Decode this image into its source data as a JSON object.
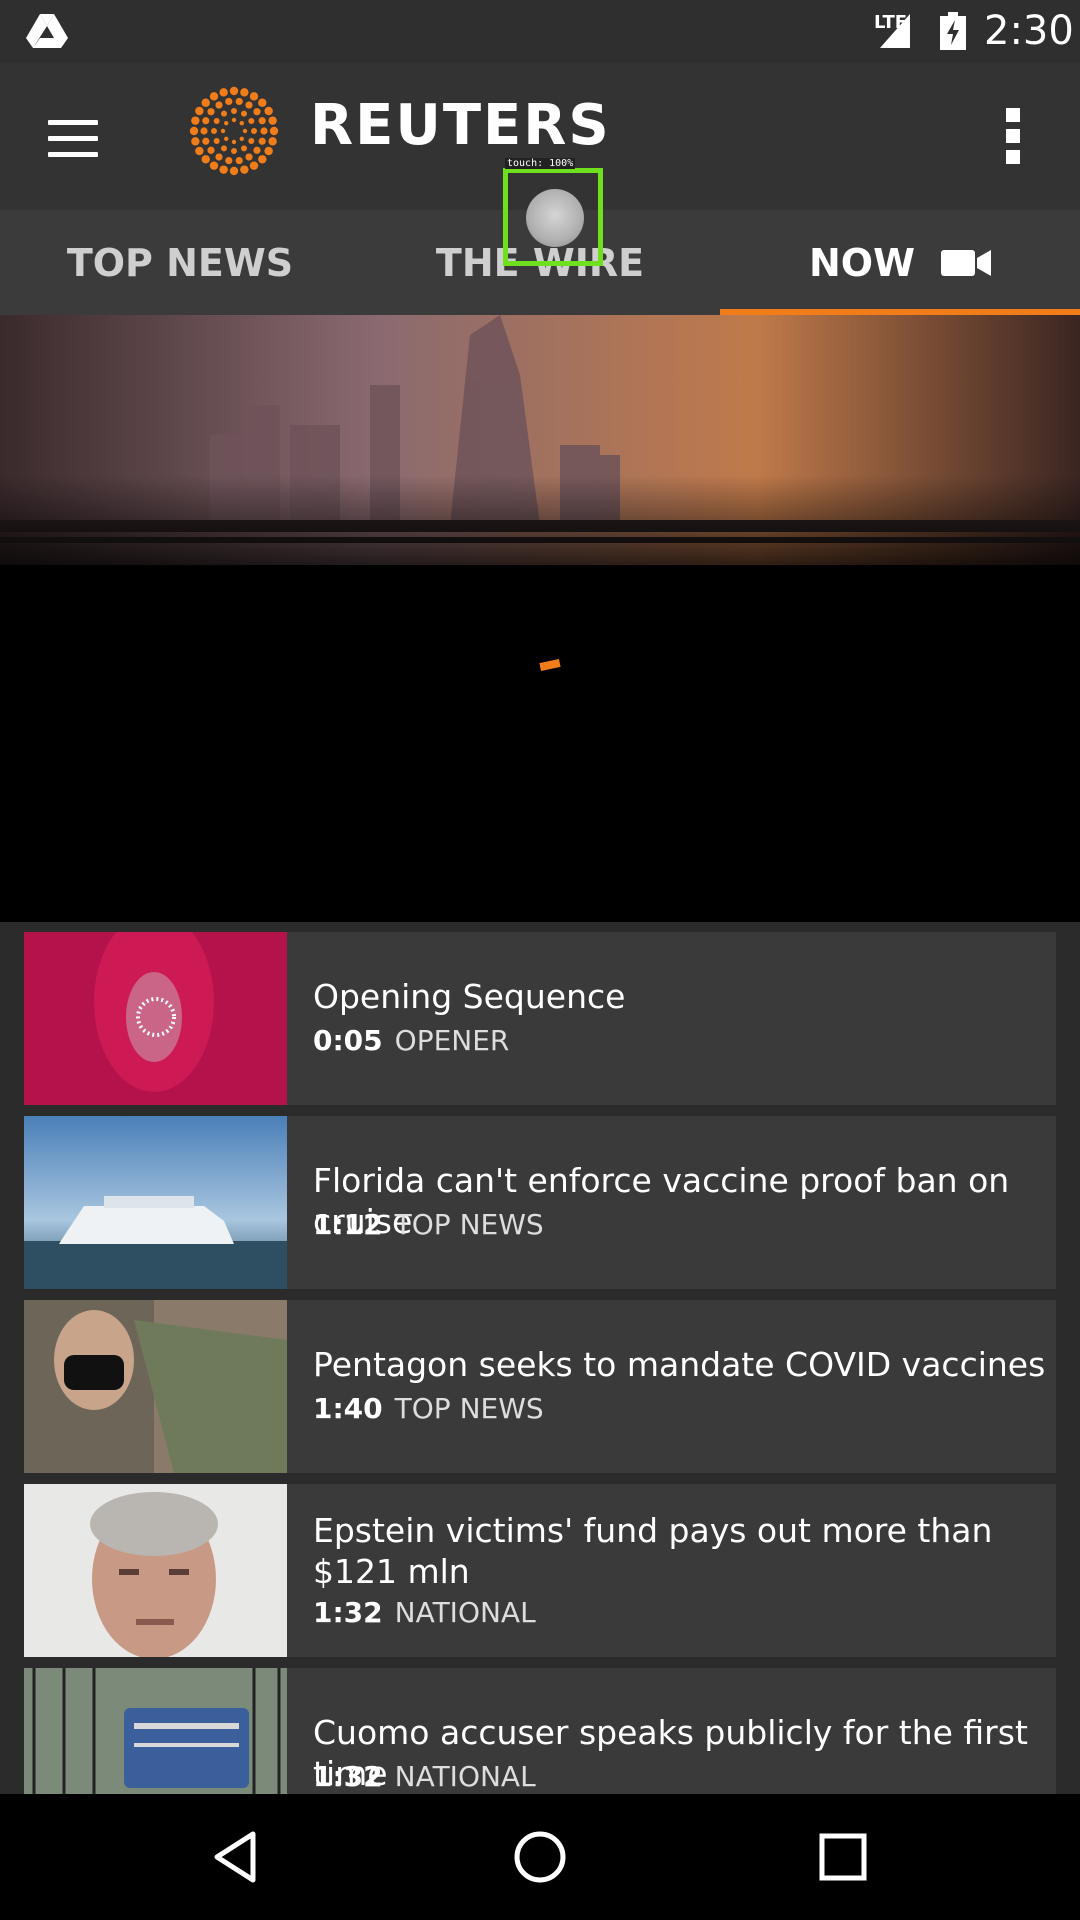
{
  "status_bar": {
    "network": "LTE",
    "time": "2:30"
  },
  "app_bar": {
    "brand": "REUTERS"
  },
  "tabs": [
    {
      "label": "TOP NEWS",
      "selected": false
    },
    {
      "label": "THE WIRE",
      "selected": false
    },
    {
      "label": "NOW",
      "selected": true
    }
  ],
  "touch_overlay": {
    "label": "touch: 100%"
  },
  "accent_color": "#f07d1a",
  "videos": [
    {
      "title": "Opening Sequence",
      "duration": "0:05",
      "category": "OPENER"
    },
    {
      "title": "Florida can't enforce vaccine proof ban on cruise",
      "duration": "1:12",
      "category": "TOP NEWS"
    },
    {
      "title": "Pentagon seeks to mandate COVID vaccines",
      "duration": "1:40",
      "category": "TOP NEWS"
    },
    {
      "title": "Epstein victims' fund pays out more than $121 mln",
      "duration": "1:32",
      "category": "NATIONAL"
    },
    {
      "title": "Cuomo accuser speaks publicly for the first time",
      "duration": "1:32",
      "category": "NATIONAL"
    }
  ]
}
